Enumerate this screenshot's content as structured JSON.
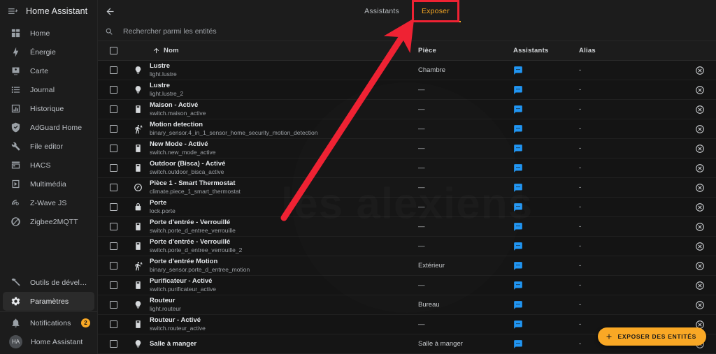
{
  "sidebar": {
    "menu_icon": "hamburger-icon",
    "title": "Home Assistant",
    "items": [
      {
        "label": "Home",
        "icon": "view-dashboard-icon"
      },
      {
        "label": "Énergie",
        "icon": "lightning-bolt-icon"
      },
      {
        "label": "Carte",
        "icon": "map-marker-icon"
      },
      {
        "label": "Journal",
        "icon": "format-list-icon"
      },
      {
        "label": "Historique",
        "icon": "chart-box-icon"
      },
      {
        "label": "AdGuard Home",
        "icon": "shield-check-icon"
      },
      {
        "label": "File editor",
        "icon": "wrench-icon"
      },
      {
        "label": "HACS",
        "icon": "store-icon"
      },
      {
        "label": "Multimédia",
        "icon": "play-box-icon"
      },
      {
        "label": "Z-Wave JS",
        "icon": "z-wave-icon"
      },
      {
        "label": "Zigbee2MQTT",
        "icon": "zigbee-icon"
      }
    ],
    "bottom_items": [
      {
        "label": "Outils de développement",
        "icon": "hammer-icon",
        "active": false
      },
      {
        "label": "Paramètres",
        "icon": "gear-icon",
        "active": true
      }
    ],
    "notifications": {
      "label": "Notifications",
      "icon": "bell-icon",
      "badge": "2"
    },
    "user": {
      "label": "Home Assistant",
      "avatar_initials": "HA"
    }
  },
  "topbar": {
    "back_icon": "arrow-left-icon",
    "tabs": [
      {
        "label": "Assistants",
        "active": false
      },
      {
        "label": "Exposer",
        "active": true
      }
    ]
  },
  "search": {
    "icon": "search-icon",
    "placeholder": "Rechercher parmi les entités",
    "value": ""
  },
  "table": {
    "sort_icon": "arrow-up-icon",
    "columns": {
      "name": "Nom",
      "piece": "Pièce",
      "assistants": "Assistants",
      "alias": "Alias"
    },
    "assistant_icon": "chat-bubble-icon",
    "remove_icon": "close-circle-icon",
    "rows": [
      {
        "icon": "lightbulb-icon",
        "name": "Lustre",
        "entity_id": "light.lustre",
        "piece": "Chambre",
        "alias": "-"
      },
      {
        "icon": "lightbulb-icon",
        "name": "Lustre",
        "entity_id": "light.lustre_2",
        "piece": "—",
        "alias": "-"
      },
      {
        "icon": "switch-icon",
        "name": "Maison - Activé",
        "entity_id": "switch.maison_active",
        "piece": "—",
        "alias": "-"
      },
      {
        "icon": "motion-icon",
        "name": "Motion detection",
        "entity_id": "binary_sensor.4_in_1_sensor_home_security_motion_detection",
        "piece": "—",
        "alias": "-"
      },
      {
        "icon": "switch-icon",
        "name": "New Mode - Activé",
        "entity_id": "switch.new_mode_active",
        "piece": "—",
        "alias": "-"
      },
      {
        "icon": "switch-icon",
        "name": "Outdoor (Bisca) - Activé",
        "entity_id": "switch.outdoor_bisca_active",
        "piece": "—",
        "alias": "-"
      },
      {
        "icon": "thermostat-icon",
        "name": "Pièce 1 - Smart Thermostat",
        "entity_id": "climate.piece_1_smart_thermostat",
        "piece": "—",
        "alias": "-"
      },
      {
        "icon": "lock-icon",
        "name": "Porte",
        "entity_id": "lock.porte",
        "piece": "—",
        "alias": "-"
      },
      {
        "icon": "switch-icon",
        "name": "Porte d'entrée - Verrouillé",
        "entity_id": "switch.porte_d_entree_verrouille",
        "piece": "—",
        "alias": "-"
      },
      {
        "icon": "switch-icon",
        "name": "Porte d'entrée - Verrouillé",
        "entity_id": "switch.porte_d_entree_verrouille_2",
        "piece": "—",
        "alias": "-"
      },
      {
        "icon": "motion-icon",
        "name": "Porte d'entrée Motion",
        "entity_id": "binary_sensor.porte_d_entree_motion",
        "piece": "Extérieur",
        "alias": "-"
      },
      {
        "icon": "switch-icon",
        "name": "Purificateur - Activé",
        "entity_id": "switch.purificateur_active",
        "piece": "—",
        "alias": "-"
      },
      {
        "icon": "lightbulb-icon",
        "name": "Routeur",
        "entity_id": "light.routeur",
        "piece": "Bureau",
        "alias": "-"
      },
      {
        "icon": "switch-icon",
        "name": "Routeur - Activé",
        "entity_id": "switch.routeur_active",
        "piece": "—",
        "alias": "-"
      },
      {
        "icon": "lightbulb-icon",
        "name": "Salle à manger",
        "entity_id": "",
        "piece": "Salle à manger",
        "alias": "-"
      }
    ]
  },
  "fab": {
    "icon": "plus-icon",
    "label": "EXPOSER DES ENTITÉS"
  },
  "watermark": {
    "text": "les alexiens"
  },
  "annotation": {
    "highlight_color": "#ef2233",
    "arrow_color": "#ef2233"
  }
}
